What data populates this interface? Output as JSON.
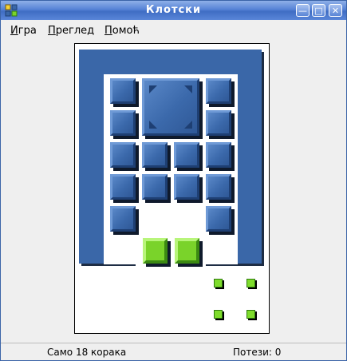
{
  "window": {
    "title": "Клотски"
  },
  "titlebar_buttons": [
    "minimize-icon",
    "maximize-icon",
    "close-icon"
  ],
  "menu": {
    "game": {
      "access_key": "И",
      "rest": "гра"
    },
    "view": {
      "access_key": "П",
      "rest": "реглед"
    },
    "help": {
      "access_key": "П",
      "rest": "омоћ"
    }
  },
  "status": {
    "hint": "Само 18 корака",
    "moves": "Потези: 0"
  },
  "colors": {
    "title_gradient": "#5683d6",
    "piece_blue": "#3b69ab",
    "goal_green": "#7ad32a",
    "board_bg": "#ffffff"
  }
}
